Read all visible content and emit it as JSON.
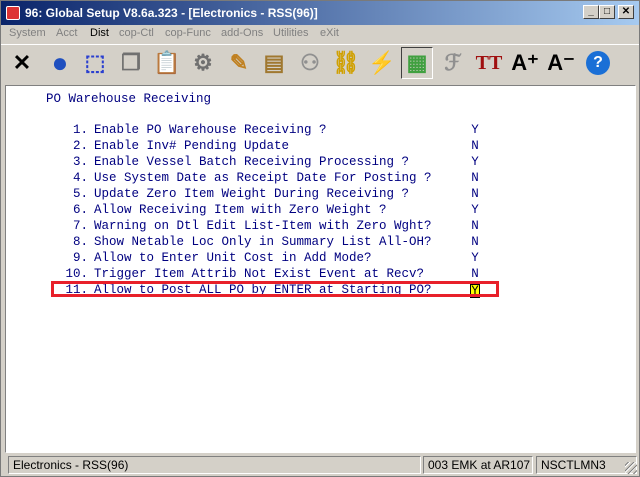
{
  "window": {
    "title": "96: Global Setup V8.6a.323 - [Electronics - RSS(96)]",
    "min_glyph": "_",
    "max_glyph": "□",
    "close_glyph": "✕"
  },
  "menu": {
    "items": [
      {
        "label": "System",
        "enabled": false
      },
      {
        "label": "Acct",
        "enabled": false
      },
      {
        "label": "Dist",
        "enabled": true
      },
      {
        "label": "cop-Ctl",
        "enabled": false
      },
      {
        "label": "cop-Func",
        "enabled": false
      },
      {
        "label": "add-Ons",
        "enabled": false
      },
      {
        "label": "Utilities",
        "enabled": false
      },
      {
        "label": "eXit",
        "enabled": false
      }
    ]
  },
  "toolbar": {
    "icons": [
      {
        "name": "exit-x-icon",
        "glyph": "✕",
        "color": "#000000"
      },
      {
        "name": "globe-icon",
        "glyph": "●",
        "color": "#1f4fbf"
      },
      {
        "name": "select-box-icon",
        "glyph": "⬚",
        "color": "#2a3fd0"
      },
      {
        "name": "copy-icon",
        "glyph": "❐",
        "color": "#707070"
      },
      {
        "name": "paste-icon",
        "glyph": "📋",
        "color": "#8a6a2a"
      },
      {
        "name": "settings-gear-icon",
        "glyph": "⚙",
        "color": "#707070"
      },
      {
        "name": "edit-pencil-icon",
        "glyph": "✎",
        "color": "#c08020"
      },
      {
        "name": "notes-icon",
        "glyph": "▤",
        "color": "#a07830"
      },
      {
        "name": "group-icon",
        "glyph": "⚇",
        "color": "#909090"
      },
      {
        "name": "link-chain-icon",
        "glyph": "⛓",
        "color": "#d0a000"
      },
      {
        "name": "lightning-icon",
        "glyph": "⚡",
        "color": "#e02020"
      },
      {
        "name": "calendar-bolt-icon",
        "glyph": "▦",
        "color": "#40a040"
      },
      {
        "name": "script-icon",
        "glyph": "ℱ",
        "color": "#909090"
      },
      {
        "name": "font-tt-icon",
        "glyph": "TT",
        "color": "#a01010"
      },
      {
        "name": "font-increase-icon",
        "glyph": "A⁺",
        "color": "#000000"
      },
      {
        "name": "font-decrease-icon",
        "glyph": "A⁻",
        "color": "#000000"
      },
      {
        "name": "help-icon",
        "glyph": "?",
        "color": "#1a6fd6"
      }
    ]
  },
  "screen": {
    "title": "PO Warehouse Receiving",
    "options": [
      {
        "num": "1.",
        "label": "Enable PO Warehouse Receiving ?",
        "value": "Y"
      },
      {
        "num": "2.",
        "label": "Enable Inv# Pending Update",
        "value": "N"
      },
      {
        "num": "3.",
        "label": "Enable Vessel Batch Receiving Processing ?",
        "value": "Y"
      },
      {
        "num": "4.",
        "label": "Use System Date as Receipt Date For Posting ?",
        "value": "N"
      },
      {
        "num": "5.",
        "label": "Update Zero Item Weight During Receiving ?",
        "value": "N"
      },
      {
        "num": "6.",
        "label": "Allow Receiving Item with Zero Weight ?",
        "value": "Y"
      },
      {
        "num": "7.",
        "label": "Warning on Dtl Edit List-Item with Zero Wght?",
        "value": "N"
      },
      {
        "num": "8.",
        "label": "Show Netable Loc Only in Summary List All-OH?",
        "value": "N"
      },
      {
        "num": "9.",
        "label": "Allow to Enter Unit Cost in Add Mode?",
        "value": "Y"
      },
      {
        "num": "10.",
        "label": "Trigger Item Attrib Not Exist Event at Recv?",
        "value": "N"
      },
      {
        "num": "11.",
        "label": "Allow to Post ALL PO by ENTER at Starting PO?",
        "value": "Y"
      }
    ]
  },
  "status": {
    "company": "Electronics - RSS(96)",
    "user": "003 EMK at AR107",
    "machine": "NSCTLMN3"
  }
}
